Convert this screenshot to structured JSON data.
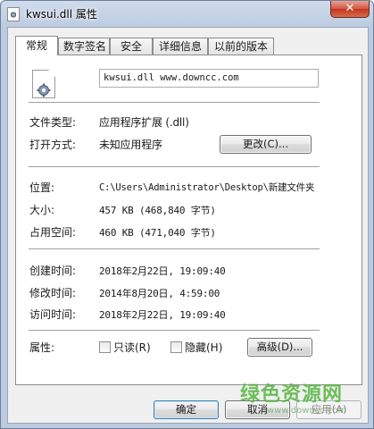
{
  "window": {
    "title": "kwsui.dll 属性",
    "close_label": "✕"
  },
  "tabs": [
    {
      "label": "常规",
      "active": true
    },
    {
      "label": "数字签名",
      "active": false
    },
    {
      "label": "安全",
      "active": false
    },
    {
      "label": "详细信息",
      "active": false
    },
    {
      "label": "以前的版本",
      "active": false
    }
  ],
  "general": {
    "file_icon": "dll-gear-file-icon",
    "filename": "kwsui.dll www.downcc.com",
    "file_type_label": "文件类型:",
    "file_type_value": "应用程序扩展 (.dll)",
    "opens_with_label": "打开方式:",
    "opens_with_value": "未知应用程序",
    "change_button": "更改(C)...",
    "location_label": "位置:",
    "location_value": "C:\\Users\\Administrator\\Desktop\\新建文件夹",
    "size_label": "大小:",
    "size_value": "457 KB (468,840 字节)",
    "size_on_disk_label": "占用空间:",
    "size_on_disk_value": "460 KB (471,040 字节)",
    "created_label": "创建时间:",
    "created_value": "2018年2月22日, 19:09:40",
    "modified_label": "修改时间:",
    "modified_value": "2014年8月20日, 4:59:00",
    "accessed_label": "访问时间:",
    "accessed_value": "2018年2月22日, 19:09:40",
    "attributes_label": "属性:",
    "readonly_label": "只读(R)",
    "readonly_checked": false,
    "hidden_label": "隐藏(H)",
    "hidden_checked": false,
    "advanced_button": "高级(D)..."
  },
  "footer": {
    "ok_button": "确定",
    "cancel_button": "取消",
    "apply_button": "应用(A)"
  },
  "watermark": {
    "main": "绿色资源网",
    "sub": "www.downcc.com"
  }
}
